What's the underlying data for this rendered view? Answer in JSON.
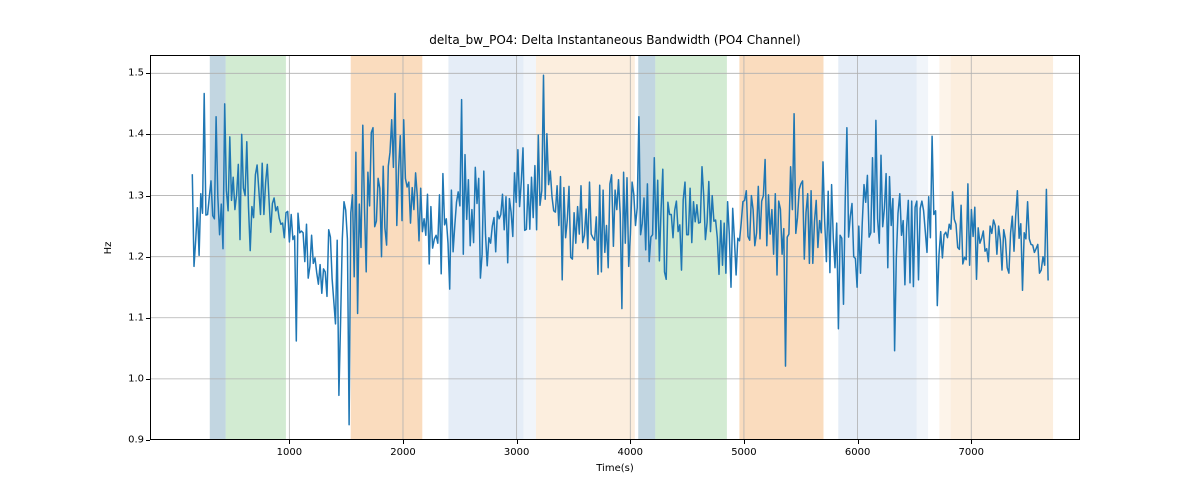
{
  "chart_data": {
    "type": "line",
    "title": "delta_bw_PO4: Delta Instantaneous Bandwidth (PO4 Channel)",
    "xlabel": "Time(s)",
    "ylabel": "Hz",
    "xlim": [
      -226,
      7957
    ],
    "ylim": [
      0.9,
      1.53
    ],
    "x_ticks": [
      1000,
      2000,
      3000,
      4000,
      5000,
      6000,
      7000
    ],
    "y_ticks": [
      0.9,
      1.0,
      1.1,
      1.2,
      1.3,
      1.4,
      1.5
    ],
    "line_color": "#1f77b4",
    "spans": [
      {
        "start": 300,
        "end": 440,
        "color": "#8fb5c9",
        "opacity": 0.55
      },
      {
        "start": 440,
        "end": 970,
        "color": "#a6d8a6",
        "opacity": 0.5
      },
      {
        "start": 1540,
        "end": 2170,
        "color": "#f5c089",
        "opacity": 0.55
      },
      {
        "start": 2400,
        "end": 3060,
        "color": "#cfdff0",
        "opacity": 0.55
      },
      {
        "start": 3060,
        "end": 3170,
        "color": "#cfdff0",
        "opacity": 0.3
      },
      {
        "start": 3170,
        "end": 4040,
        "color": "#f9e0c3",
        "opacity": 0.55
      },
      {
        "start": 4070,
        "end": 4220,
        "color": "#8fb5c9",
        "opacity": 0.55
      },
      {
        "start": 4220,
        "end": 4850,
        "color": "#a6d8a6",
        "opacity": 0.5
      },
      {
        "start": 4960,
        "end": 5700,
        "color": "#f5c089",
        "opacity": 0.55
      },
      {
        "start": 5830,
        "end": 6520,
        "color": "#cfdff0",
        "opacity": 0.55
      },
      {
        "start": 6520,
        "end": 6620,
        "color": "#cfdff0",
        "opacity": 0.3
      },
      {
        "start": 6720,
        "end": 6820,
        "color": "#f9e0c3",
        "opacity": 0.35
      },
      {
        "start": 6820,
        "end": 7720,
        "color": "#f9e0c3",
        "opacity": 0.55
      }
    ],
    "series": [
      {
        "name": "delta_bw_PO4",
        "x_start": 146,
        "x_step": 15,
        "values": [
          1.335,
          1.184,
          1.227,
          1.28,
          1.202,
          1.303,
          1.271,
          1.467,
          1.268,
          1.269,
          1.298,
          1.324,
          1.267,
          1.262,
          1.429,
          1.299,
          1.236,
          1.286,
          1.213,
          1.45,
          1.308,
          1.275,
          1.396,
          1.292,
          1.33,
          1.277,
          1.301,
          1.351,
          1.228,
          1.4,
          1.312,
          1.3,
          1.388,
          1.281,
          1.21,
          1.282,
          1.264,
          1.334,
          1.35,
          1.31,
          1.269,
          1.353,
          1.269,
          1.321,
          1.351,
          1.294,
          1.24,
          1.287,
          1.296,
          1.275,
          1.282,
          1.263,
          1.253,
          1.255,
          1.231,
          1.272,
          1.274,
          1.224,
          1.269,
          1.228,
          1.234,
          1.062,
          1.271,
          1.239,
          1.242,
          1.239,
          1.192,
          1.253,
          1.165,
          1.184,
          1.235,
          1.189,
          1.198,
          1.174,
          1.155,
          1.187,
          1.14,
          1.18,
          1.175,
          1.135,
          1.244,
          1.232,
          1.164,
          1.127,
          1.09,
          1.227,
          0.973,
          1.095,
          1.229,
          1.29,
          1.276,
          1.229,
          0.925,
          1.272,
          1.301,
          1.167,
          1.371,
          1.107,
          1.286,
          1.215,
          1.415,
          1.278,
          1.175,
          1.338,
          1.283,
          1.403,
          1.411,
          1.249,
          1.258,
          1.328,
          1.312,
          1.2,
          1.348,
          1.247,
          1.219,
          1.348,
          1.371,
          1.424,
          1.346,
          1.467,
          1.251,
          1.343,
          1.398,
          1.259,
          1.424,
          1.328,
          1.314,
          1.322,
          1.255,
          1.313,
          1.277,
          1.337,
          1.299,
          1.226,
          1.312,
          1.241,
          1.262,
          1.235,
          1.302,
          1.188,
          1.282,
          1.214,
          1.229,
          1.235,
          1.222,
          1.301,
          1.172,
          1.336,
          1.252,
          1.262,
          1.222,
          1.147,
          1.309,
          1.208,
          1.251,
          1.289,
          1.306,
          1.283,
          1.457,
          1.204,
          1.367,
          1.261,
          1.326,
          1.218,
          1.277,
          1.223,
          1.346,
          1.287,
          1.328,
          1.165,
          1.204,
          1.34,
          1.237,
          1.185,
          1.231,
          1.222,
          1.25,
          1.264,
          1.208,
          1.274,
          1.262,
          1.269,
          1.302,
          1.244,
          1.298,
          1.19,
          1.295,
          1.273,
          1.233,
          1.337,
          1.289,
          1.375,
          1.282,
          1.323,
          1.378,
          1.243,
          1.245,
          1.318,
          1.245,
          1.33,
          1.264,
          1.349,
          1.244,
          1.399,
          1.284,
          1.308,
          1.497,
          1.294,
          1.401,
          1.318,
          1.34,
          1.298,
          1.275,
          1.273,
          1.316,
          1.251,
          1.331,
          1.162,
          1.313,
          1.231,
          1.26,
          1.315,
          1.199,
          1.196,
          1.272,
          1.222,
          1.282,
          1.237,
          1.316,
          1.223,
          1.235,
          1.278,
          1.213,
          1.322,
          1.237,
          1.231,
          1.227,
          1.265,
          1.171,
          1.317,
          1.175,
          1.309,
          1.207,
          1.251,
          1.182,
          1.319,
          1.334,
          1.217,
          1.309,
          1.277,
          1.326,
          1.27,
          1.115,
          1.338,
          1.222,
          1.329,
          1.184,
          1.237,
          1.322,
          1.302,
          1.251,
          1.28,
          1.429,
          1.236,
          1.255,
          1.296,
          1.211,
          1.319,
          1.192,
          1.232,
          1.236,
          1.362,
          1.229,
          1.325,
          1.193,
          1.278,
          1.343,
          1.175,
          1.163,
          1.289,
          1.269,
          1.269,
          1.231,
          1.276,
          1.291,
          1.241,
          1.252,
          1.178,
          1.293,
          1.322,
          1.236,
          1.236,
          1.312,
          1.223,
          1.29,
          1.257,
          1.285,
          1.255,
          1.256,
          1.347,
          1.3,
          1.228,
          1.256,
          1.323,
          1.241,
          1.3,
          1.258,
          1.26,
          1.231,
          1.171,
          1.259,
          1.186,
          1.255,
          1.173,
          1.29,
          1.237,
          1.15,
          1.279,
          1.229,
          1.17,
          1.23,
          1.226,
          1.255,
          1.29,
          1.292,
          1.308,
          1.233,
          1.227,
          1.3,
          1.277,
          1.218,
          1.239,
          1.315,
          1.229,
          1.291,
          1.3,
          1.359,
          1.218,
          1.301,
          1.237,
          1.277,
          1.204,
          1.303,
          1.17,
          1.291,
          1.278,
          1.204,
          1.246,
          1.021,
          1.232,
          1.237,
          1.347,
          1.277,
          1.434,
          1.238,
          1.264,
          1.31,
          1.319,
          1.324,
          1.196,
          1.272,
          1.303,
          1.189,
          1.308,
          1.189,
          1.258,
          1.292,
          1.215,
          1.259,
          1.239,
          1.355,
          1.257,
          1.192,
          1.307,
          1.174,
          1.318,
          1.229,
          1.182,
          1.255,
          1.082,
          1.235,
          1.23,
          1.122,
          1.291,
          1.411,
          1.232,
          1.266,
          1.287,
          1.2,
          1.197,
          1.15,
          1.25,
          1.173,
          1.253,
          1.318,
          1.289,
          1.333,
          1.232,
          1.239,
          1.362,
          1.24,
          1.423,
          1.262,
          1.222,
          1.366,
          1.249,
          1.279,
          1.336,
          1.182,
          1.331,
          1.251,
          1.295,
          1.046,
          1.197,
          1.271,
          1.303,
          1.235,
          1.259,
          1.154,
          1.247,
          1.292,
          1.157,
          1.291,
          1.151,
          1.281,
          1.291,
          1.162,
          1.279,
          1.291,
          1.275,
          1.241,
          1.207,
          1.298,
          1.231,
          1.397,
          1.269,
          1.275,
          1.12,
          1.203,
          1.241,
          1.198,
          1.236,
          1.24,
          1.231,
          1.253,
          1.245,
          1.306,
          1.261,
          1.253,
          1.215,
          1.212,
          1.284,
          1.188,
          1.199,
          1.195,
          1.319,
          1.186,
          1.277,
          1.233,
          1.281,
          1.163,
          1.247,
          1.222,
          1.23,
          1.242,
          1.209,
          1.213,
          1.192,
          1.25,
          1.238,
          1.26,
          1.251,
          1.204,
          1.25,
          1.228,
          1.178,
          1.244,
          1.229,
          1.182,
          1.173,
          1.239,
          1.266,
          1.209,
          1.267,
          1.308,
          1.23,
          1.254,
          1.145,
          1.239,
          1.229,
          1.29,
          1.229,
          1.22,
          1.219,
          1.207,
          1.213,
          1.22,
          1.173,
          1.178,
          1.2,
          1.186,
          1.31,
          1.161
        ]
      }
    ]
  },
  "layout": {
    "fig_w": 1200,
    "fig_h": 500,
    "ax_left": 150,
    "ax_top": 55,
    "ax_w": 930,
    "ax_h": 385
  }
}
